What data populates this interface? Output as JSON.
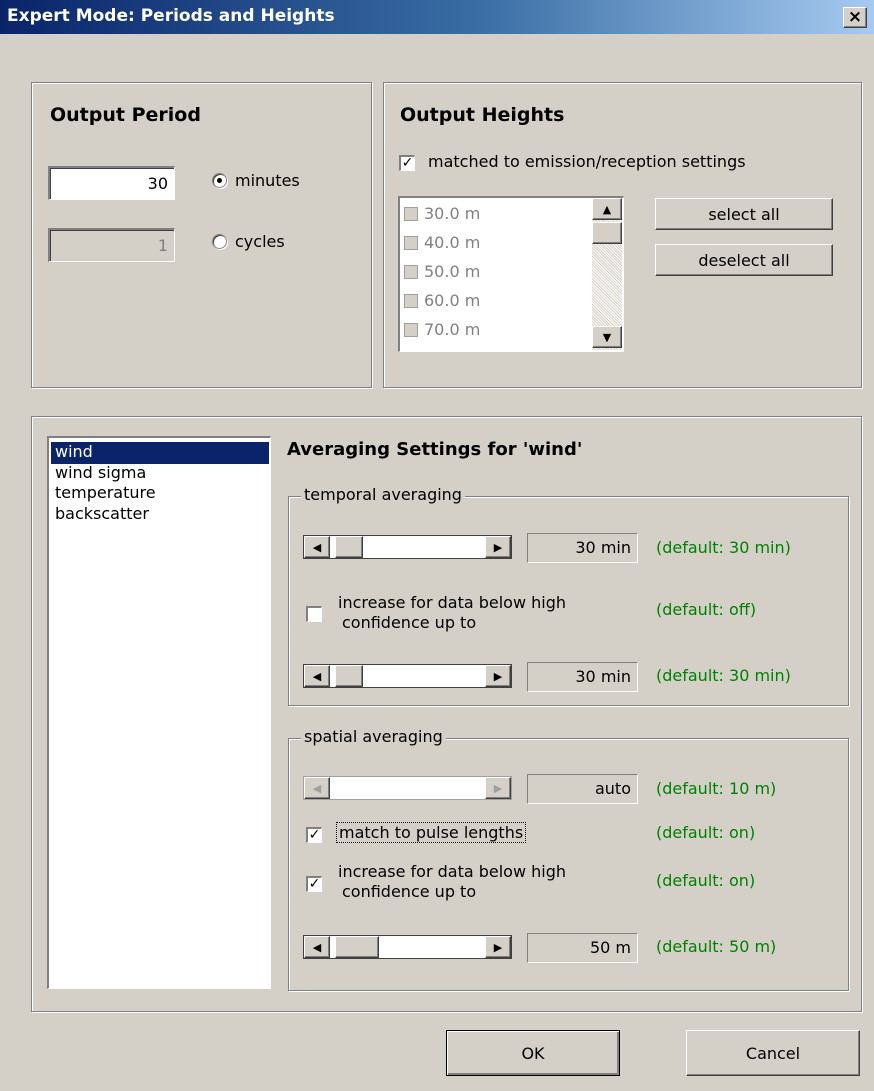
{
  "window": {
    "title": "Expert Mode: Periods and Heights",
    "close_glyph": "×"
  },
  "output_period": {
    "title": "Output Period",
    "minutes_value": "30",
    "cycles_value": "1",
    "minutes_label": "minutes",
    "cycles_label": "cycles",
    "selected": "minutes"
  },
  "output_heights": {
    "title": "Output Heights",
    "matched_label": "matched to emission/reception settings",
    "matched_checked": true,
    "heights": [
      "30.0 m",
      "40.0 m",
      "50.0 m",
      "60.0 m",
      "70.0 m"
    ],
    "select_all": "select all",
    "deselect_all": "deselect all"
  },
  "variables": {
    "items": [
      "wind",
      "wind sigma",
      "temperature",
      "backscatter"
    ],
    "selected": "wind"
  },
  "averaging": {
    "title": "Averaging Settings for 'wind'",
    "temporal": {
      "legend": "temporal averaging",
      "main_value": "30 min",
      "main_default": "(default: 30 min)",
      "increase_label_1": "increase for data below high",
      "increase_label_2": "confidence up to",
      "increase_checked": false,
      "increase_default": "(default: off)",
      "max_value": "30 min",
      "max_default": "(default: 30 min)"
    },
    "spatial": {
      "legend": "spatial averaging",
      "main_value": "auto",
      "main_default": "(default: 10 m)",
      "match_label": "match to pulse lengths",
      "match_checked": true,
      "match_default": "(default: on)",
      "increase_label_1": "increase for data below high",
      "increase_label_2": "confidence up to",
      "increase_checked": true,
      "increase_default": "(default: on)",
      "max_value": "50 m",
      "max_default": "(default: 50 m)"
    }
  },
  "buttons": {
    "ok": "OK",
    "cancel": "Cancel"
  },
  "icons": {
    "arrow_up": "▲",
    "arrow_down": "▼",
    "arrow_left": "◀",
    "arrow_right": "▶",
    "check": "✓"
  }
}
